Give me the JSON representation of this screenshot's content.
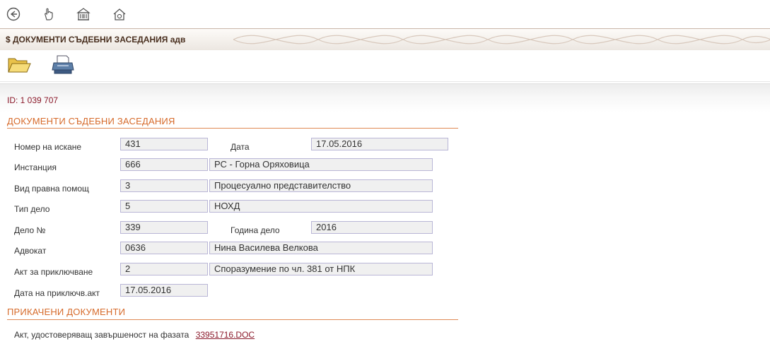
{
  "nav": {
    "icons": [
      "back-icon",
      "hand-pointer-icon",
      "building-icon",
      "home-icon"
    ]
  },
  "window_title": "$ ДОКУМЕНТИ СЪДЕБНИ ЗАСЕДАНИЯ адв",
  "toolbar": {
    "icons": [
      "open-folder-icon",
      "printer-icon"
    ]
  },
  "record_id": "ID: 1 039 707",
  "section_main": "ДОКУМЕНТИ СЪДЕБНИ ЗАСЕДАНИЯ",
  "form": {
    "request_no": {
      "label": "Номер на искане",
      "value": "431"
    },
    "date": {
      "label": "Дата",
      "value": "17.05.2016"
    },
    "instance": {
      "label": "Инстанция",
      "code": "666",
      "name": "РС -  Горна Оряховица"
    },
    "legal_aid_type": {
      "label": "Вид правна помощ",
      "code": "3",
      "name": "Процесуално представителство"
    },
    "case_type": {
      "label": "Тип дело",
      "code": "5",
      "name": "НОХД"
    },
    "case_no": {
      "label": "Дело №",
      "value": "339"
    },
    "case_year": {
      "label": "Година дело",
      "value": "2016"
    },
    "lawyer": {
      "label": "Адвокат",
      "code": "0636",
      "name": "Нина Василева Велкова"
    },
    "closing_act": {
      "label": "Акт за приключване",
      "code": "2",
      "name": "Споразумение по чл. 381 от НПК"
    },
    "closing_act_date": {
      "label": "Дата на приключв.акт",
      "value": "17.05.2016"
    }
  },
  "section_attachments": "ПРИКАЧЕНИ ДОКУМЕНТИ",
  "attachment": {
    "label": "Акт, удостоверяващ завършеност на фазата",
    "file": "33951716.DOC"
  },
  "colors": {
    "accent": "#d66a2a",
    "id_text": "#8b1a2b",
    "field_border": "#b9b6d6",
    "field_bg": "#f0f0f0"
  }
}
